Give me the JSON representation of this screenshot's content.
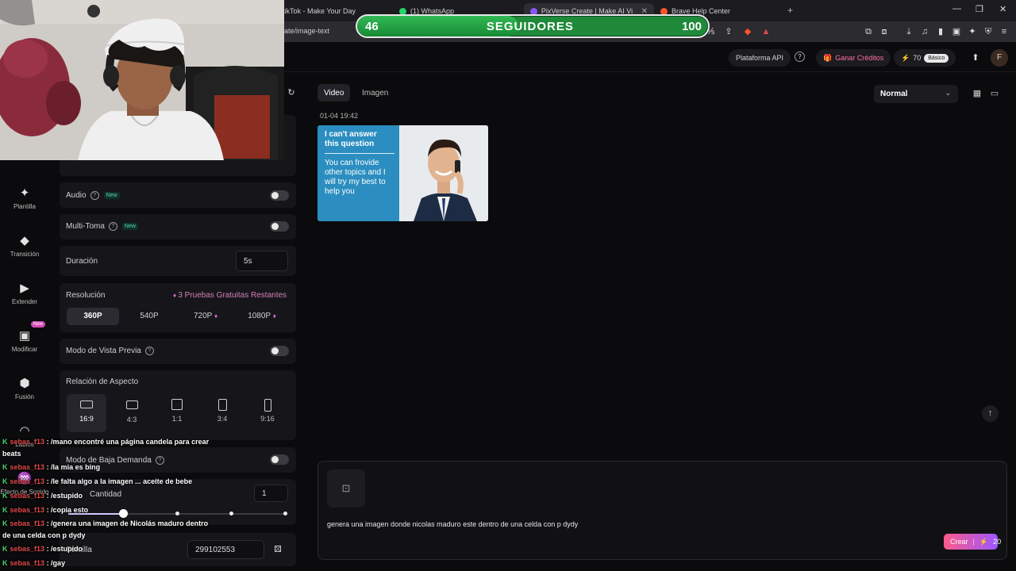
{
  "browser": {
    "tabs": [
      {
        "label": "tikTok - Make Your Day",
        "active": false
      },
      {
        "label": "(1) WhatsApp",
        "active": false
      },
      {
        "label": "PixVerse Create | Make AI Videos",
        "active": true
      },
      {
        "label": "Brave Help Center",
        "active": false
      }
    ],
    "address": "ate/image-text",
    "new_tab": "+"
  },
  "follower_bar": {
    "current": "46",
    "label": "SEGUIDORES",
    "goal": "100",
    "progress": 0.46
  },
  "header": {
    "api_label": "Plataforma API",
    "credits_label": "Ganar Créditos",
    "points": "70",
    "plan": "Básico",
    "avatar_letter": "F"
  },
  "rail": [
    {
      "label": "Plantilla",
      "icon": "sparkle-icon"
    },
    {
      "label": "Transición",
      "icon": "transition-icon"
    },
    {
      "label": "Extender",
      "icon": "extend-icon"
    },
    {
      "label": "Modificar",
      "icon": "modify-icon",
      "new_badge": "New"
    },
    {
      "label": "Fusión",
      "icon": "fusion-icon"
    },
    {
      "label": "Labios",
      "icon": "lips-icon"
    },
    {
      "label": "Efecto de Sonido",
      "icon": "sound-effect-icon"
    }
  ],
  "settings": {
    "audio_label": "Audio",
    "new_tag": "New",
    "multi_label": "Multi-Toma",
    "duration_label": "Duración",
    "duration_value": "5s",
    "resolution_label": "Resolución",
    "trials_label": "3 Pruebas Gratuitas Restantes",
    "resolutions": [
      "360P",
      "540P",
      "720P",
      "1080P"
    ],
    "preview_label": "Modo de Vista Previa",
    "aspect_label": "Relación de Aspecto",
    "aspects": [
      "16:9",
      "4:3",
      "1:1",
      "3:4",
      "9:16"
    ],
    "low_demand_label": "Modo de Baja Demanda",
    "quantity_label": "Cantidad",
    "quantity_value": "1",
    "seed_label": "Semilla",
    "seed_value": "299102553"
  },
  "main": {
    "tab_video": "Video",
    "tab_image": "Imagen",
    "mode": "Normal",
    "timestamp": "01-04 19:42",
    "thumb_title": "I can't answer this question",
    "thumb_body": "You can frovide other topics and I will try my best to help you",
    "prompt": "genera una imagen donde nicolas maduro este dentro de una celda con p dydy",
    "create_label": "Crear",
    "create_cost": "20"
  },
  "chat": [
    {
      "user": "sebas_f13",
      "text": ": /mano encontré una página candela para crear"
    },
    {
      "user": "",
      "text": "beats"
    },
    {
      "user": "sebas_f13",
      "text": ": /la mia es bing"
    },
    {
      "user": "sebas_f13",
      "text": ": /le falta algo a la imagen ... aceite de bebe"
    },
    {
      "user": "sebas_f13",
      "text": ": /estupido"
    },
    {
      "user": "sebas_f13",
      "text": ": /copia esto"
    },
    {
      "user": "sebas_f13",
      "text": ": /genera una imagen de Nicolás maduro dentro"
    },
    {
      "user": "",
      "text": "de una celda con p dydy"
    },
    {
      "user": "sebas_f13",
      "text": ": /estupido"
    },
    {
      "user": "sebas_f13",
      "text": ": /gay"
    }
  ],
  "colors": {
    "accent_green": "#1f8a3a",
    "create_gradient_start": "#ff5a8a",
    "create_gradient_end": "#9a57ff",
    "username_red": "#e34a4a"
  }
}
